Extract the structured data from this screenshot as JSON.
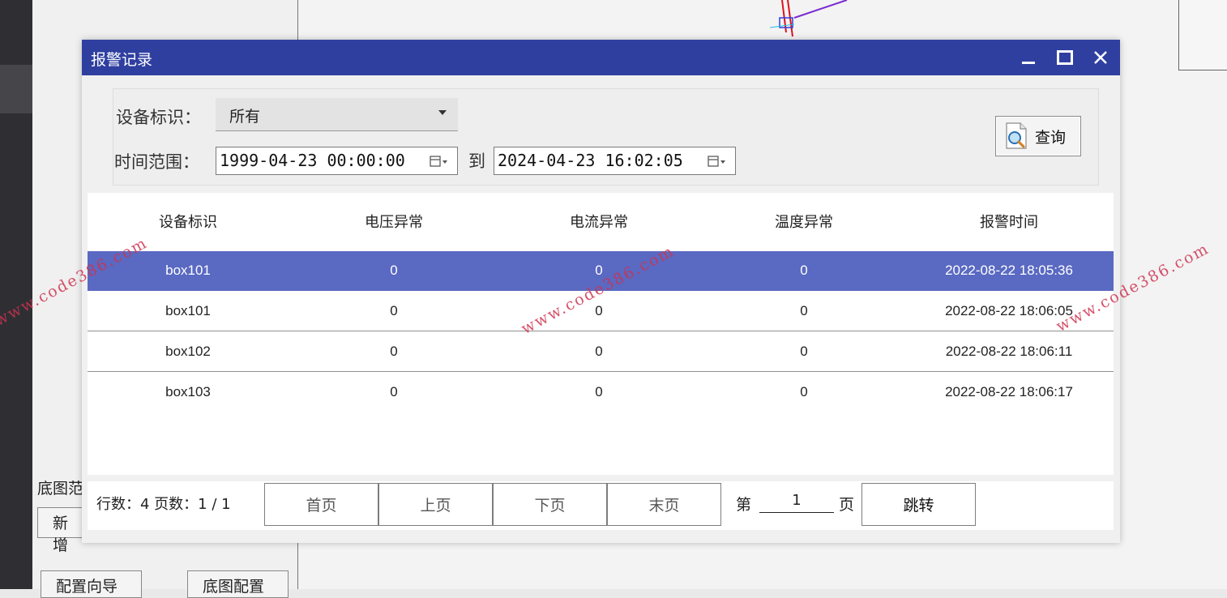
{
  "background": {
    "left_label": "底图范",
    "add_button": "新增",
    "config_wizard_button": "配置向导",
    "basemap_config_button": "底图配置"
  },
  "dialog": {
    "title": "报警记录",
    "title_bar_color": "#2f3fa0",
    "window_controls": {
      "minimize": "minimize-icon",
      "maximize": "maximize-icon",
      "close": "close-icon"
    },
    "filter": {
      "device_label": "设备标识：",
      "device_value": "所有",
      "time_label": "时间范围：",
      "start_time": "1999-04-23 00:00:00",
      "to_label": "到",
      "end_time": "2024-04-23 16:02:05",
      "query_button": "查询",
      "query_icon": "magnifier-document-icon"
    },
    "table": {
      "columns": [
        "设备标识",
        "电压异常",
        "电流异常",
        "温度异常",
        "报警时间"
      ],
      "selected_row_color": "#5a69c2",
      "rows": [
        [
          "box101",
          "0",
          "0",
          "0",
          "2022-08-22 18:05:36"
        ],
        [
          "box101",
          "0",
          "0",
          "0",
          "2022-08-22 18:06:05"
        ],
        [
          "box102",
          "0",
          "0",
          "0",
          "2022-08-22 18:06:11"
        ],
        [
          "box103",
          "0",
          "0",
          "0",
          "2022-08-22 18:06:17"
        ]
      ]
    },
    "pager": {
      "row_count_text": "行数：4  页数：1 / 1",
      "first_page": "首页",
      "prev_page": "上页",
      "next_page": "下页",
      "last_page": "末页",
      "page_prefix": "第",
      "page_value": "1",
      "page_suffix": "页",
      "jump_button": "跳转"
    }
  },
  "watermark": {
    "text": "www.code386.com",
    "color": "#cd3250"
  }
}
